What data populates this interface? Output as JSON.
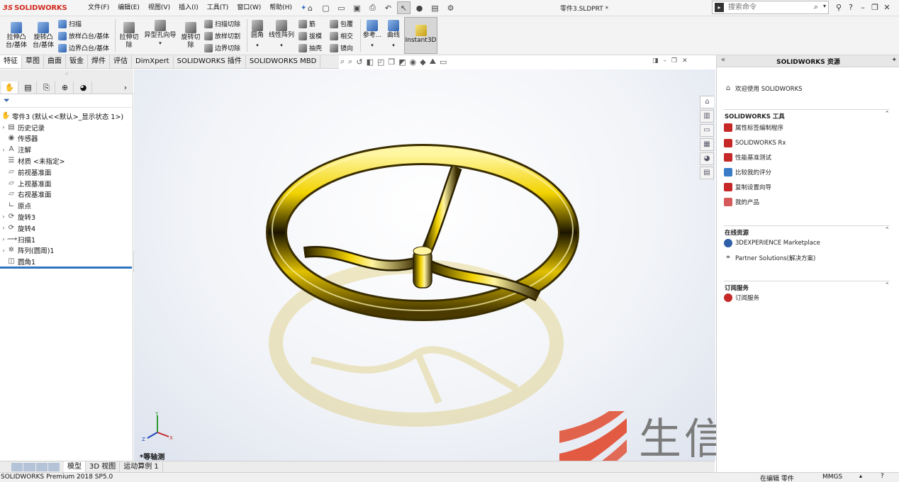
{
  "app": {
    "logo_ds": "3S",
    "logo_name": "SOLIDWORKS",
    "doc_title": "零件3.SLDPRT *",
    "pin_icon": "pin-icon"
  },
  "menus": [
    "文件(F)",
    "编辑(E)",
    "视图(V)",
    "插入(I)",
    "工具(T)",
    "窗口(W)",
    "帮助(H)"
  ],
  "search": {
    "placeholder": "搜索命令"
  },
  "ribbon": {
    "big": [
      {
        "label": "拉伸凸\n台/基体"
      },
      {
        "label": "旋转凸\n台/基体"
      },
      {
        "label": "拉伸切\n除"
      },
      {
        "label": "异型孔向导"
      },
      {
        "label": "旋转切\n除"
      },
      {
        "label": "圆角"
      },
      {
        "label": "线性阵列"
      },
      {
        "label": "参考..."
      },
      {
        "label": "曲线"
      },
      {
        "label": "Instant3D"
      }
    ],
    "small": [
      {
        "label": "扫描"
      },
      {
        "label": "放样凸台/基体"
      },
      {
        "label": "边界凸台/基体"
      },
      {
        "label": "扫描切除"
      },
      {
        "label": "放样切割"
      },
      {
        "label": "边界切除"
      },
      {
        "label": "筋"
      },
      {
        "label": "拔模"
      },
      {
        "label": "抽壳"
      },
      {
        "label": "包覆"
      },
      {
        "label": "相交"
      },
      {
        "label": "镜向"
      }
    ]
  },
  "tabs": [
    {
      "label": "特征",
      "active": true
    },
    {
      "label": "草图"
    },
    {
      "label": "曲面"
    },
    {
      "label": "钣金"
    },
    {
      "label": "焊件"
    },
    {
      "label": "评估"
    },
    {
      "label": "DimXpert"
    },
    {
      "label": "SOLIDWORKS 插件"
    },
    {
      "label": "SOLIDWORKS MBD"
    }
  ],
  "tree": {
    "root": "零件3 (默认<<默认>_显示状态 1>)",
    "items": [
      {
        "label": "历史记录",
        "expander": true,
        "icon": "history-icon"
      },
      {
        "label": "传感器",
        "expander": false,
        "icon": "sensor-icon"
      },
      {
        "label": "注解",
        "expander": true,
        "icon": "annotation-icon"
      },
      {
        "label": "材质 <未指定>",
        "expander": false,
        "icon": "material-icon"
      },
      {
        "label": "前视基准面",
        "expander": false,
        "icon": "plane-icon"
      },
      {
        "label": "上视基准面",
        "expander": false,
        "icon": "plane-icon"
      },
      {
        "label": "右视基准面",
        "expander": false,
        "icon": "plane-icon"
      },
      {
        "label": "原点",
        "expander": false,
        "icon": "origin-icon"
      },
      {
        "label": "旋转3",
        "expander": true,
        "icon": "revolve-icon"
      },
      {
        "label": "旋转4",
        "expander": true,
        "icon": "revolve-icon"
      },
      {
        "label": "扫描1",
        "expander": true,
        "icon": "sweep-icon"
      },
      {
        "label": "阵列(圆周)1",
        "expander": true,
        "icon": "pattern-icon"
      },
      {
        "label": "圆角1",
        "expander": false,
        "icon": "fillet-icon"
      }
    ]
  },
  "viewport": {
    "view_label": "*等轴测",
    "triad": {
      "x": "X",
      "y": "Y",
      "z": "Z"
    },
    "part_color": "#f2d200"
  },
  "bottom_tabs": [
    {
      "label": "模型",
      "active": true
    },
    {
      "label": "3D 视图"
    },
    {
      "label": "运动算例 1"
    }
  ],
  "status": {
    "version": "SOLIDWORKS Premium 2018 SP5.0",
    "editing": "在编辑 零件",
    "units": "MMGS"
  },
  "resources": {
    "title": "SOLIDWORKS 资源",
    "welcome": "欢迎使用 SOLIDWORKS",
    "tools_title": "SOLIDWORKS 工具",
    "tools": [
      "属性标签编制程序",
      "SOLIDWORKS Rx",
      "性能基准测试",
      "比较我的评分",
      "复制设置向导",
      "我的产品"
    ],
    "online_title": "在线资源",
    "online": [
      "3DEXPERIENCE Marketplace",
      "Partner Solutions(解决方案)"
    ],
    "sub_title": "订阅服务",
    "sub": [
      "订阅服务"
    ]
  },
  "watermark": {
    "text": "生信科技"
  },
  "colors": {
    "accent": "#2e74c0",
    "brand": "#d12a21",
    "watermark_red": "#e04a2e"
  }
}
